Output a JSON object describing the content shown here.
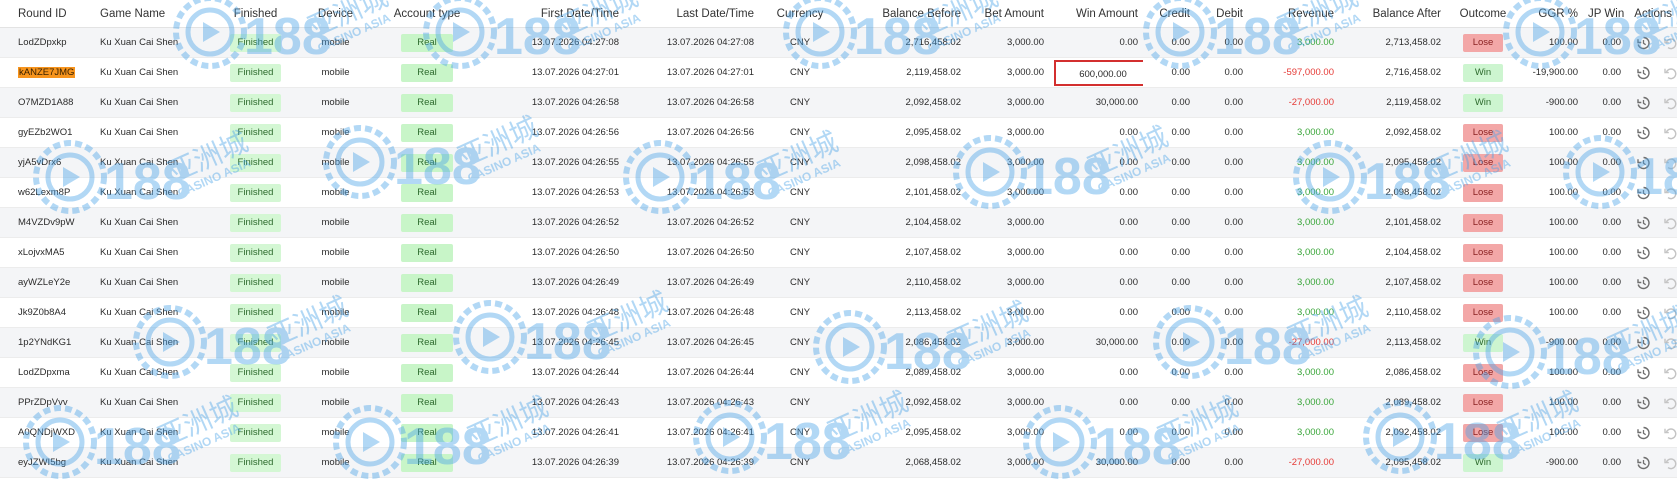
{
  "columns": {
    "round_id": "Round ID",
    "game_name": "Game Name",
    "finished": "Finished",
    "device": "Device",
    "account_type": "Account type",
    "first_date": "First Date/Time",
    "last_date": "Last Date/Time",
    "currency": "Currency",
    "balance_before": "Balance Before",
    "bet_amount": "Bet Amount",
    "win_amount": "Win Amount",
    "credit": "Credit",
    "debit": "Debit",
    "revenue": "Revenue",
    "balance_after": "Balance After",
    "outcome": "Outcome",
    "ggr": "GGR %",
    "jp_win": "JP Win",
    "actions": "Actions"
  },
  "watermark": {
    "brand": "188",
    "chinese": "亚洲城",
    "english": "CASINO ASIA"
  },
  "colors": {
    "positive": "#3aa63a",
    "negative": "#e53935",
    "lose_badge": "#f3a7a7",
    "win_badge": "#cdf5d0",
    "highlight": "#f7941d",
    "annotation_box": "#d32f2f"
  },
  "rows": [
    {
      "round_id": "LodZDpxkp",
      "game_name": "Ku Xuan Cai Shen",
      "finished": "Finished",
      "device": "mobile",
      "account_type": "Real",
      "first_date": "13.07.2026 04:27:08",
      "last_date": "13.07.2026 04:27:08",
      "currency": "CNY",
      "balance_before": "2,716,458.02",
      "bet_amount": "3,000.00",
      "win_amount": "0.00",
      "credit": "0.00",
      "debit": "0.00",
      "revenue": "3,000.00",
      "balance_after": "2,713,458.02",
      "outcome": "Lose",
      "ggr": "100.00",
      "jp_win": "0.00"
    },
    {
      "round_id": "kANZE7JMG",
      "game_name": "Ku Xuan Cai Shen",
      "finished": "Finished",
      "device": "mobile",
      "account_type": "Real",
      "first_date": "13.07.2026 04:27:01",
      "last_date": "13.07.2026 04:27:01",
      "currency": "CNY",
      "balance_before": "2,119,458.02",
      "bet_amount": "3,000.00",
      "win_amount": "600,000.00",
      "credit": "0.00",
      "debit": "0.00",
      "revenue": "-597,000.00",
      "balance_after": "2,716,458.02",
      "outcome": "Win",
      "ggr": "-19,900.00",
      "jp_win": "0.00"
    },
    {
      "round_id": "O7MZD1A88",
      "game_name": "Ku Xuan Cai Shen",
      "finished": "Finished",
      "device": "mobile",
      "account_type": "Real",
      "first_date": "13.07.2026 04:26:58",
      "last_date": "13.07.2026 04:26:58",
      "currency": "CNY",
      "balance_before": "2,092,458.02",
      "bet_amount": "3,000.00",
      "win_amount": "30,000.00",
      "credit": "0.00",
      "debit": "0.00",
      "revenue": "-27,000.00",
      "balance_after": "2,119,458.02",
      "outcome": "Win",
      "ggr": "-900.00",
      "jp_win": "0.00"
    },
    {
      "round_id": "gyEZb2WO1",
      "game_name": "Ku Xuan Cai Shen",
      "finished": "Finished",
      "device": "mobile",
      "account_type": "Real",
      "first_date": "13.07.2026 04:26:56",
      "last_date": "13.07.2026 04:26:56",
      "currency": "CNY",
      "balance_before": "2,095,458.02",
      "bet_amount": "3,000.00",
      "win_amount": "0.00",
      "credit": "0.00",
      "debit": "0.00",
      "revenue": "3,000.00",
      "balance_after": "2,092,458.02",
      "outcome": "Lose",
      "ggr": "100.00",
      "jp_win": "0.00"
    },
    {
      "round_id": "yjA5vDrx6",
      "game_name": "Ku Xuan Cai Shen",
      "finished": "Finished",
      "device": "mobile",
      "account_type": "Real",
      "first_date": "13.07.2026 04:26:55",
      "last_date": "13.07.2026 04:26:55",
      "currency": "CNY",
      "balance_before": "2,098,458.02",
      "bet_amount": "3,000.00",
      "win_amount": "0.00",
      "credit": "0.00",
      "debit": "0.00",
      "revenue": "3,000.00",
      "balance_after": "2,095,458.02",
      "outcome": "Lose",
      "ggr": "100.00",
      "jp_win": "0.00"
    },
    {
      "round_id": "w62Lexm8P",
      "game_name": "Ku Xuan Cai Shen",
      "finished": "Finished",
      "device": "mobile",
      "account_type": "Real",
      "first_date": "13.07.2026 04:26:53",
      "last_date": "13.07.2026 04:26:53",
      "currency": "CNY",
      "balance_before": "2,101,458.02",
      "bet_amount": "3,000.00",
      "win_amount": "0.00",
      "credit": "0.00",
      "debit": "0.00",
      "revenue": "3,000.00",
      "balance_after": "2,098,458.02",
      "outcome": "Lose",
      "ggr": "100.00",
      "jp_win": "0.00"
    },
    {
      "round_id": "M4VZDv9pW",
      "game_name": "Ku Xuan Cai Shen",
      "finished": "Finished",
      "device": "mobile",
      "account_type": "Real",
      "first_date": "13.07.2026 04:26:52",
      "last_date": "13.07.2026 04:26:52",
      "currency": "CNY",
      "balance_before": "2,104,458.02",
      "bet_amount": "3,000.00",
      "win_amount": "0.00",
      "credit": "0.00",
      "debit": "0.00",
      "revenue": "3,000.00",
      "balance_after": "2,101,458.02",
      "outcome": "Lose",
      "ggr": "100.00",
      "jp_win": "0.00"
    },
    {
      "round_id": "xLojvxMA5",
      "game_name": "Ku Xuan Cai Shen",
      "finished": "Finished",
      "device": "mobile",
      "account_type": "Real",
      "first_date": "13.07.2026 04:26:50",
      "last_date": "13.07.2026 04:26:50",
      "currency": "CNY",
      "balance_before": "2,107,458.02",
      "bet_amount": "3,000.00",
      "win_amount": "0.00",
      "credit": "0.00",
      "debit": "0.00",
      "revenue": "3,000.00",
      "balance_after": "2,104,458.02",
      "outcome": "Lose",
      "ggr": "100.00",
      "jp_win": "0.00"
    },
    {
      "round_id": "ayWZLeY2e",
      "game_name": "Ku Xuan Cai Shen",
      "finished": "Finished",
      "device": "mobile",
      "account_type": "Real",
      "first_date": "13.07.2026 04:26:49",
      "last_date": "13.07.2026 04:26:49",
      "currency": "CNY",
      "balance_before": "2,110,458.02",
      "bet_amount": "3,000.00",
      "win_amount": "0.00",
      "credit": "0.00",
      "debit": "0.00",
      "revenue": "3,000.00",
      "balance_after": "2,107,458.02",
      "outcome": "Lose",
      "ggr": "100.00",
      "jp_win": "0.00"
    },
    {
      "round_id": "Jk9Z0b8A4",
      "game_name": "Ku Xuan Cai Shen",
      "finished": "Finished",
      "device": "mobile",
      "account_type": "Real",
      "first_date": "13.07.2026 04:26:48",
      "last_date": "13.07.2026 04:26:48",
      "currency": "CNY",
      "balance_before": "2,113,458.02",
      "bet_amount": "3,000.00",
      "win_amount": "0.00",
      "credit": "0.00",
      "debit": "0.00",
      "revenue": "3,000.00",
      "balance_after": "2,110,458.02",
      "outcome": "Lose",
      "ggr": "100.00",
      "jp_win": "0.00"
    },
    {
      "round_id": "1p2YNdKG1",
      "game_name": "Ku Xuan Cai Shen",
      "finished": "Finished",
      "device": "mobile",
      "account_type": "Real",
      "first_date": "13.07.2026 04:26:45",
      "last_date": "13.07.2026 04:26:45",
      "currency": "CNY",
      "balance_before": "2,086,458.02",
      "bet_amount": "3,000.00",
      "win_amount": "30,000.00",
      "credit": "0.00",
      "debit": "0.00",
      "revenue": "-27,000.00",
      "balance_after": "2,113,458.02",
      "outcome": "Win",
      "ggr": "-900.00",
      "jp_win": "0.00"
    },
    {
      "round_id": "LodZDpxma",
      "game_name": "Ku Xuan Cai Shen",
      "finished": "Finished",
      "device": "mobile",
      "account_type": "Real",
      "first_date": "13.07.2026 04:26:44",
      "last_date": "13.07.2026 04:26:44",
      "currency": "CNY",
      "balance_before": "2,089,458.02",
      "bet_amount": "3,000.00",
      "win_amount": "0.00",
      "credit": "0.00",
      "debit": "0.00",
      "revenue": "3,000.00",
      "balance_after": "2,086,458.02",
      "outcome": "Lose",
      "ggr": "100.00",
      "jp_win": "0.00"
    },
    {
      "round_id": "PPrZDpVvv",
      "game_name": "Ku Xuan Cai Shen",
      "finished": "Finished",
      "device": "mobile",
      "account_type": "Real",
      "first_date": "13.07.2026 04:26:43",
      "last_date": "13.07.2026 04:26:43",
      "currency": "CNY",
      "balance_before": "2,092,458.02",
      "bet_amount": "3,000.00",
      "win_amount": "0.00",
      "credit": "0.00",
      "debit": "0.00",
      "revenue": "3,000.00",
      "balance_after": "2,089,458.02",
      "outcome": "Lose",
      "ggr": "100.00",
      "jp_win": "0.00"
    },
    {
      "round_id": "A0QNDjWXD",
      "game_name": "Ku Xuan Cai Shen",
      "finished": "Finished",
      "device": "mobile",
      "account_type": "Real",
      "first_date": "13.07.2026 04:26:41",
      "last_date": "13.07.2026 04:26:41",
      "currency": "CNY",
      "balance_before": "2,095,458.02",
      "bet_amount": "3,000.00",
      "win_amount": "0.00",
      "credit": "0.00",
      "debit": "0.00",
      "revenue": "3,000.00",
      "balance_after": "2,092,458.02",
      "outcome": "Lose",
      "ggr": "100.00",
      "jp_win": "0.00"
    },
    {
      "round_id": "eyJZWI5bg",
      "game_name": "Ku Xuan Cai Shen",
      "finished": "Finished",
      "device": "mobile",
      "account_type": "Real",
      "first_date": "13.07.2026 04:26:39",
      "last_date": "13.07.2026 04:26:39",
      "currency": "CNY",
      "balance_before": "2,068,458.02",
      "bet_amount": "3,000.00",
      "win_amount": "30,000.00",
      "credit": "0.00",
      "debit": "0.00",
      "revenue": "-27,000.00",
      "balance_after": "2,095,458.02",
      "outcome": "Win",
      "ggr": "-900.00",
      "jp_win": "0.00"
    }
  ]
}
